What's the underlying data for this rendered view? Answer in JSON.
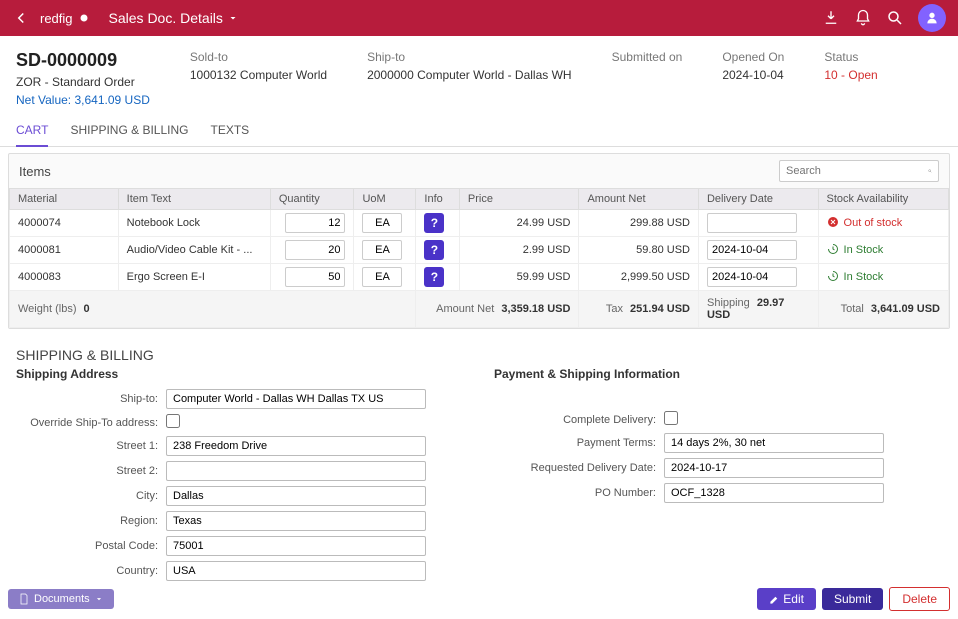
{
  "topbar": {
    "brand": "redfig",
    "title": "Sales Doc. Details"
  },
  "header": {
    "order_id": "SD-0000009",
    "order_type": "ZOR - Standard Order",
    "net_value": "Net Value: 3,641.09 USD",
    "sold_to_label": "Sold-to",
    "sold_to_value": "1000132 Computer World",
    "ship_to_label": "Ship-to",
    "ship_to_value": "2000000 Computer World - Dallas WH",
    "submitted_label": "Submitted on",
    "submitted_value": "",
    "opened_label": "Opened On",
    "opened_value": "2024-10-04",
    "status_label": "Status",
    "status_value": "10 - Open"
  },
  "tabs": {
    "cart": "CART",
    "shipping": "SHIPPING & BILLING",
    "texts": "TEXTS"
  },
  "items_section": {
    "title": "Items",
    "search_placeholder": "Search",
    "columns": {
      "material": "Material",
      "item_text": "Item Text",
      "quantity": "Quantity",
      "uom": "UoM",
      "info": "Info",
      "price": "Price",
      "amount_net": "Amount Net",
      "delivery_date": "Delivery Date",
      "stock": "Stock Availability"
    },
    "rows": [
      {
        "material": "4000074",
        "text": "Notebook Lock",
        "qty": "12",
        "uom": "EA",
        "price": "24.99 USD",
        "amount": "299.88 USD",
        "delivery": "",
        "stock_status": "out",
        "stock_text": "Out of stock"
      },
      {
        "material": "4000081",
        "text": "Audio/Video Cable Kit - ...",
        "qty": "20",
        "uom": "EA",
        "price": "2.99 USD",
        "amount": "59.80 USD",
        "delivery": "2024-10-04",
        "stock_status": "in",
        "stock_text": "In Stock"
      },
      {
        "material": "4000083",
        "text": "Ergo Screen E-I",
        "qty": "50",
        "uom": "EA",
        "price": "59.99 USD",
        "amount": "2,999.50 USD",
        "delivery": "2024-10-04",
        "stock_status": "in",
        "stock_text": "In Stock"
      }
    ],
    "totals": {
      "weight_label": "Weight (lbs)",
      "weight_value": "0",
      "amount_net_label": "Amount Net",
      "amount_net_value": "3,359.18 USD",
      "tax_label": "Tax",
      "tax_value": "251.94 USD",
      "shipping_label": "Shipping",
      "shipping_value": "29.97 USD",
      "total_label": "Total",
      "total_value": "3,641.09 USD"
    }
  },
  "shipping_section": {
    "title": "SHIPPING & BILLING",
    "address_title": "Shipping Address",
    "payment_title": "Payment & Shipping Information",
    "labels": {
      "ship_to": "Ship-to:",
      "override": "Override Ship-To address:",
      "street1": "Street 1:",
      "street2": "Street 2:",
      "city": "City:",
      "region": "Region:",
      "postal": "Postal Code:",
      "country": "Country:",
      "complete": "Complete Delivery:",
      "terms": "Payment Terms:",
      "req_date": "Requested Delivery Date:",
      "po": "PO Number:"
    },
    "values": {
      "ship_to": "Computer World - Dallas WH Dallas TX US",
      "street1": "238 Freedom Drive",
      "street2": "",
      "city": "Dallas",
      "region": "Texas",
      "postal": "75001",
      "country": "USA",
      "terms": "14 days 2%, 30 net",
      "req_date": "2024-10-17",
      "po": "OCF_1328"
    }
  },
  "footer": {
    "documents": "Documents",
    "edit": "Edit",
    "submit": "Submit",
    "delete": "Delete"
  }
}
